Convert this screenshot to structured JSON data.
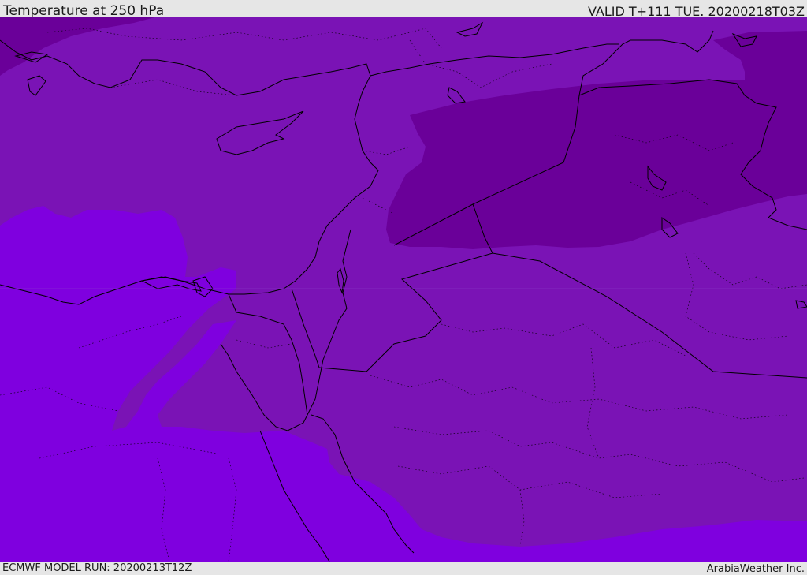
{
  "header": {
    "title": "Temperature at 250 hPa",
    "valid": "VALID T+111 TUE. 20200218T03Z"
  },
  "footer": {
    "model_run": "ECMWF MODEL RUN: 20200213T12Z",
    "credit": "ArabiaWeather Inc."
  },
  "map": {
    "colors": {
      "warm_band": "#7f00df",
      "mid_band": "#7a13b5",
      "cold_band": "#6a0099",
      "coastline": "#000000"
    }
  }
}
